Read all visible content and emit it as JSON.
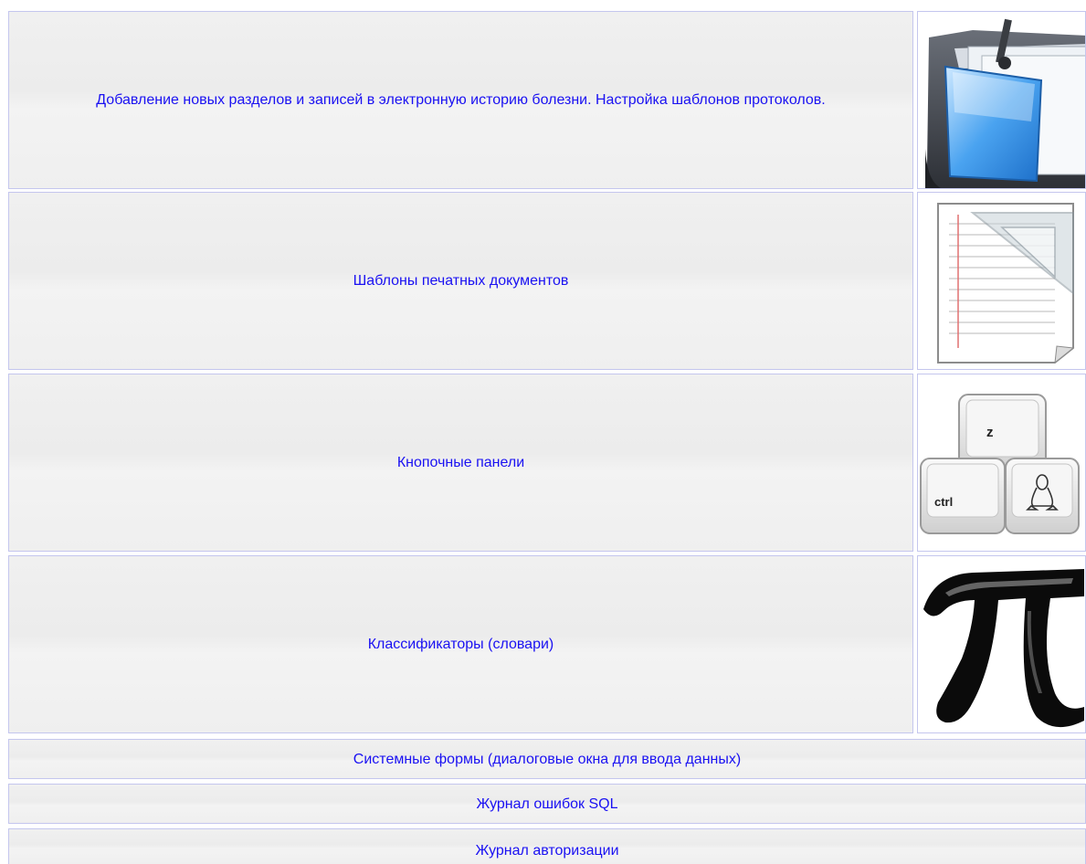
{
  "menu": {
    "items": [
      {
        "label": "Добавление новых разделов и записей в электронную историю болезни. Настройка шаблонов протоколов.",
        "icon": "folder-icon"
      },
      {
        "label": "Шаблоны печатных документов",
        "icon": "document-template-icon"
      },
      {
        "label": "Кнопочные панели",
        "icon": "keyboard-keys-icon"
      },
      {
        "label": "Классификаторы (словари)",
        "icon": "pi-icon"
      },
      {
        "label": "Системные формы (диалоговые окна для ввода данных)"
      },
      {
        "label": "Журнал ошибок SQL"
      },
      {
        "label": "Журнал авторизации"
      }
    ],
    "keys": {
      "top": "z",
      "left": "ctrl"
    }
  },
  "colors": {
    "link": "#1a11f2",
    "border": "#c4c6ee",
    "cell_bg": "#eeeeee"
  }
}
